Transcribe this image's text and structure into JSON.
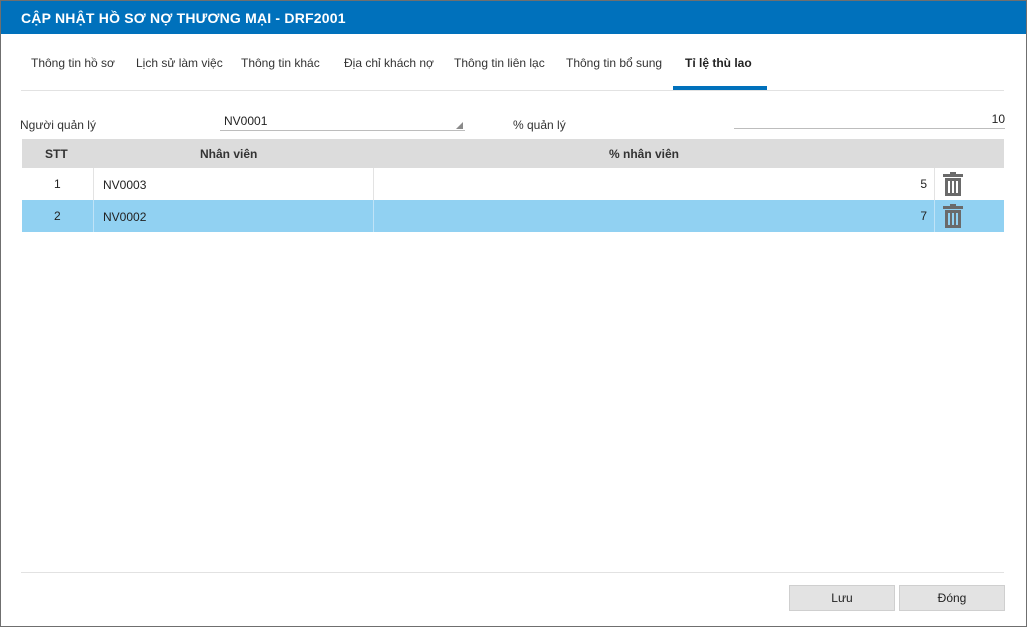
{
  "window": {
    "title": "CẬP NHẬT HỒ SƠ NỢ THƯƠNG MẠI - DRF2001"
  },
  "tabs": [
    {
      "label": "Thông tin hồ sơ"
    },
    {
      "label": "Lịch sử làm việc"
    },
    {
      "label": "Thông tin khác"
    },
    {
      "label": "Địa chỉ khách nợ"
    },
    {
      "label": "Thông tin liên lạc"
    },
    {
      "label": "Thông tin bổ sung"
    },
    {
      "label": "Tỉ lệ thù lao",
      "active": true
    }
  ],
  "form": {
    "manager_label": "Người quản lý",
    "manager_value": "NV0001",
    "manager_percent_label": "% quản lý",
    "manager_percent_value": "10"
  },
  "table": {
    "columns": [
      "STT",
      "Nhân viên",
      "% nhân viên"
    ],
    "rows": [
      {
        "stt": "1",
        "employee": "NV0003",
        "percent": "5",
        "selected": false
      },
      {
        "stt": "2",
        "employee": "NV0002",
        "percent": "7",
        "selected": true
      }
    ],
    "delete_icon": "trash-icon"
  },
  "buttons": {
    "save": "Lưu",
    "close": "Đóng"
  },
  "colors": {
    "accent": "#0071bc",
    "selected_row": "#91d1f2",
    "header_bg": "#dcdcdc"
  }
}
